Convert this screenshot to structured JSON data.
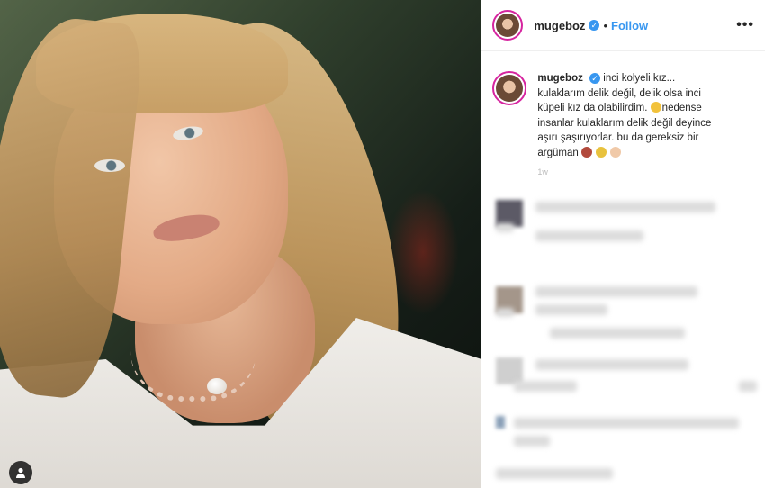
{
  "post": {
    "username": "mugeboz",
    "follow_label": "Follow",
    "more_label": "•••",
    "caption": {
      "username": "mugeboz",
      "line1": "inci kolyeli kız...",
      "line2": "kulaklarım delik değil, delik olsa inci",
      "line3": "küpeli kız da olabilirdim.",
      "line3b": "nedense",
      "line4": "insanlar kulaklarım delik değil deyince",
      "line5": "aşırı şaşırıyorlar. bu da gereksiz bir",
      "line6": "argüman",
      "time_ago": "1w"
    }
  },
  "icons": {
    "user_tag": "user-tag-icon",
    "verified": "verified-badge-icon"
  },
  "colors": {
    "follow": "#3897f0",
    "verified": "#3897f0",
    "story_ring": "#d6249f"
  }
}
